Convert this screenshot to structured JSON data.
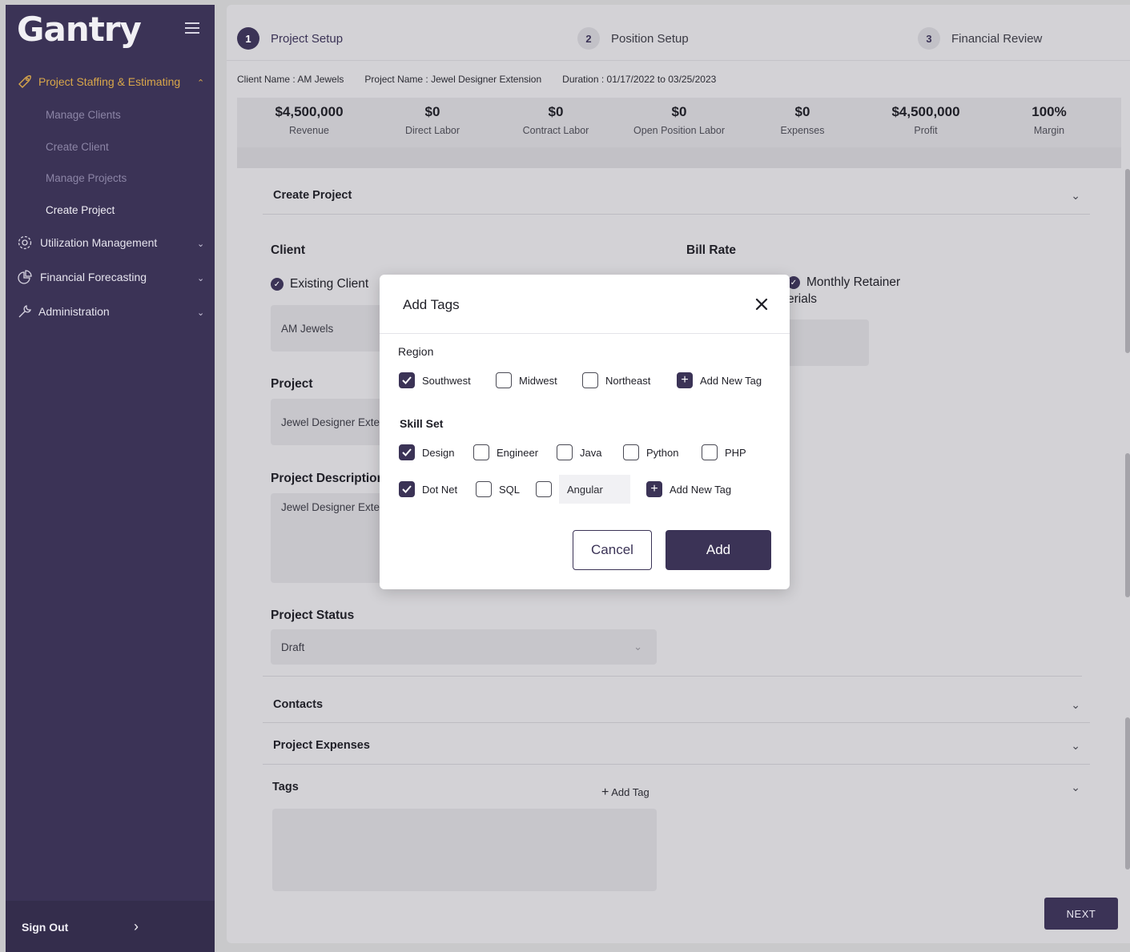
{
  "sidebar": {
    "logo": "Gantry",
    "nav": [
      {
        "label": "Project Staffing & Estimating",
        "icon": "rocket-icon"
      },
      {
        "label": "Utilization Management",
        "icon": "gear-icon"
      },
      {
        "label": "Financial Forecasting",
        "icon": "pie-chart-icon"
      },
      {
        "label": "Administration",
        "icon": "wrench-icon"
      }
    ],
    "sub_items": [
      "Manage Clients",
      "Create Client",
      "Manage Projects",
      "Create Project"
    ],
    "sign_out": "Sign Out"
  },
  "stepper": {
    "steps": [
      {
        "num": "1",
        "label": "Project Setup"
      },
      {
        "num": "2",
        "label": "Position Setup"
      },
      {
        "num": "3",
        "label": "Financial Review"
      }
    ]
  },
  "meta": {
    "client": "Client Name : AM Jewels",
    "project": "Project Name : Jewel Designer Extension",
    "duration": "Duration : 01/17/2022 to 03/25/2023"
  },
  "summary": [
    {
      "value": "$4,500,000",
      "label": "Revenue"
    },
    {
      "value": "$0",
      "label": "Direct Labor"
    },
    {
      "value": "$0",
      "label": "Contract Labor"
    },
    {
      "value": "$0",
      "label": "Open Position Labor"
    },
    {
      "value": "$0",
      "label": "Expenses"
    },
    {
      "value": "$4,500,000",
      "label": "Profit"
    },
    {
      "value": "100%",
      "label": "Margin"
    }
  ],
  "form": {
    "section_title": "Create Project",
    "client_label": "Client",
    "existing_client": "Existing Client",
    "client_value": "AM Jewels",
    "bill_rate_label": "Bill Rate",
    "monthly_retainer": "Monthly Retainer",
    "materials_partial": "erials",
    "project_label": "Project",
    "project_value": "Jewel Designer Exte",
    "description_label": "Project Descriptior",
    "description_value": "Jewel Designer Exte",
    "status_label": "Project Status",
    "status_value": "Draft",
    "contacts": "Contacts",
    "expenses": "Project Expenses",
    "tags": "Tags",
    "add_tag": "Add Tag",
    "next": "NEXT"
  },
  "modal": {
    "title": "Add Tags",
    "region_title": "Region",
    "region_options": [
      {
        "label": "Southwest",
        "checked": true
      },
      {
        "label": "Midwest",
        "checked": false
      },
      {
        "label": "Northeast",
        "checked": false
      }
    ],
    "region_add": "Add New Tag",
    "skill_title": "Skill Set",
    "skills_row1": [
      {
        "label": "Design",
        "checked": true
      },
      {
        "label": "Engineer",
        "checked": false
      },
      {
        "label": "Java",
        "checked": false
      },
      {
        "label": "Python",
        "checked": false
      },
      {
        "label": "PHP",
        "checked": false
      }
    ],
    "skills_row2": [
      {
        "label": "Dot Net",
        "checked": true
      },
      {
        "label": "SQL",
        "checked": false
      },
      {
        "label": "Angular",
        "checked": false
      }
    ],
    "skill_add": "Add New Tag",
    "cancel": "Cancel",
    "add": "Add"
  },
  "colors": {
    "primary": "#3b3356",
    "accent": "#d9a74a"
  }
}
